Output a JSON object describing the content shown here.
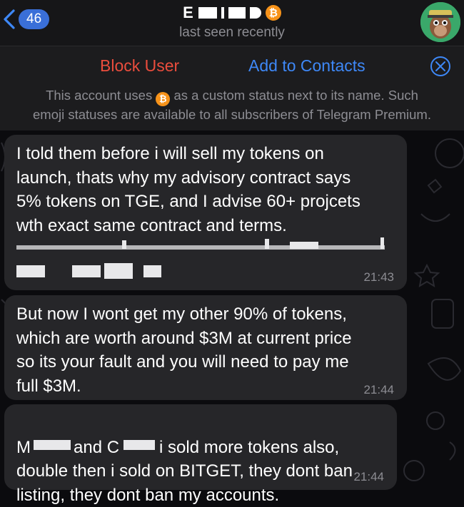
{
  "header": {
    "back_count": "46",
    "name": "E",
    "status_icon": "bitcoin-icon",
    "subtitle": "last seen recently"
  },
  "action_bar": {
    "block_label": "Block User",
    "add_label": "Add to Contacts",
    "notice_prefix": "This account uses",
    "notice_suffix_line1": "as a custom status next to its name. Such",
    "notice_line2": "emoji statuses are available to all subscribers of Telegram Premium."
  },
  "messages": [
    {
      "text": "I told them before i will sell my tokens on\nlaunch, thats why my advisory contract says\n5% tokens on TGE, and I advise 60+ projcets\nwth exact same contract and terms.",
      "time": "21:43"
    },
    {
      "text": "But now I wont get my other 90% of tokens,\nwhich are worth around $3M at current price\nso its your fault and you will need to pay me\nfull $3M.",
      "time": "21:44"
    },
    {
      "line1_a": "M",
      "line1_b": "and C",
      "line1_c": "i sold more tokens also,",
      "text": "double then i sold on BITGET, they dont ban\nlisting, they dont ban my accounts.",
      "time": "21:44"
    }
  ],
  "colors": {
    "accent": "#3e88f7",
    "danger": "#eb4d3d",
    "bubble": "#262629",
    "bitcoin": "#f7931a"
  }
}
